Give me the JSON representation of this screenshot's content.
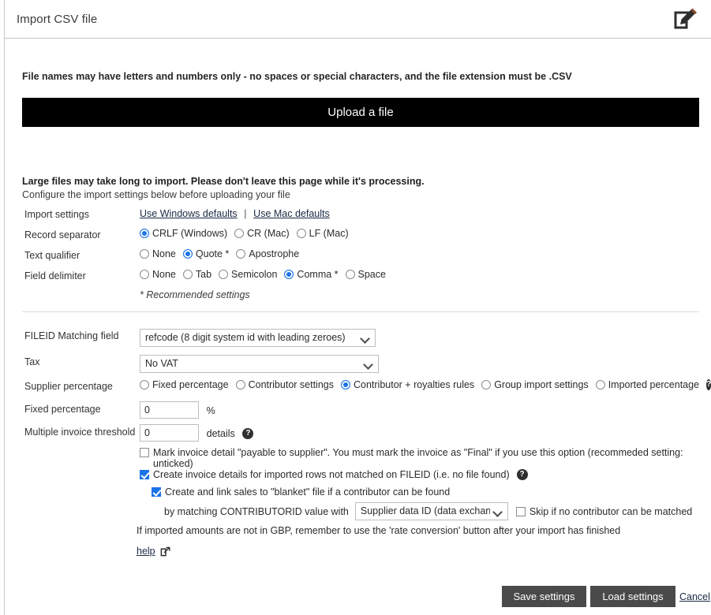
{
  "window": {
    "title": "Import CSV file",
    "edit_icon": "edit-pencil-square-icon"
  },
  "notice": "File names may have letters and numbers only - no spaces or special characters, and the file extension must be .CSV",
  "upload": {
    "label": "Upload a file"
  },
  "warning": {
    "bold": "Large files may take long to import. Please don't leave this page while it's processing.",
    "sub": "Configure the import settings below before uploading your file"
  },
  "import_settings": {
    "label": "Import settings",
    "windows_defaults": "Use Windows defaults",
    "separator": "|",
    "mac_defaults": "Use Mac defaults"
  },
  "record_separator": {
    "label": "Record separator",
    "options": [
      {
        "label": "CRLF (Windows)",
        "checked": true
      },
      {
        "label": "CR (Mac)",
        "checked": false
      },
      {
        "label": "LF (Mac)",
        "checked": false
      }
    ]
  },
  "text_qualifier": {
    "label": "Text qualifier",
    "options": [
      {
        "label": "None",
        "checked": false
      },
      {
        "label": "Quote *",
        "checked": true
      },
      {
        "label": "Apostrophe",
        "checked": false
      }
    ]
  },
  "field_delimiter": {
    "label": "Field delimiter",
    "options": [
      {
        "label": "None",
        "checked": false
      },
      {
        "label": "Tab",
        "checked": false
      },
      {
        "label": "Semicolon",
        "checked": false
      },
      {
        "label": "Comma *",
        "checked": true
      },
      {
        "label": "Space",
        "checked": false
      }
    ]
  },
  "recommended_note": "* Recommended settings",
  "fileid_matching": {
    "label": "FILEID Matching field",
    "value": "refcode (8 digit system id with leading zeroes)",
    "options": [
      "refcode (8 digit system id with leading zeroes)"
    ]
  },
  "tax": {
    "label": "Tax",
    "value": "No VAT",
    "options": [
      "No VAT"
    ]
  },
  "supplier_percentage": {
    "label": "Supplier percentage",
    "options": [
      {
        "label": "Fixed percentage",
        "checked": false
      },
      {
        "label": "Contributor settings",
        "checked": false
      },
      {
        "label": "Contributor + royalties rules",
        "checked": true
      },
      {
        "label": "Group import settings",
        "checked": false
      },
      {
        "label": "Imported percentage",
        "checked": false
      }
    ],
    "help_icon": "help-circle-icon"
  },
  "fixed_percentage": {
    "label": "Fixed percentage",
    "value": "0",
    "suffix": "%"
  },
  "multiple_invoice_threshold": {
    "label": "Multiple invoice threshold",
    "value": "0",
    "suffix": "details",
    "help_icon": "help-circle-icon"
  },
  "checkboxes": {
    "payable_to_supplier": {
      "label": "Mark invoice detail \"payable to supplier\". You must mark the invoice as \"Final\" if you use this option (recommeded setting: unticked)",
      "checked": false
    },
    "create_invoice_details": {
      "label": "Create invoice details for imported rows not matched on FILEID (i.e. no file found)",
      "checked": true,
      "help_icon": "help-circle-icon"
    },
    "create_link_blanket": {
      "label": "Create and link sales to \"blanket\" file if a contributor can be found",
      "checked": true
    },
    "skip_if_no_contributor": {
      "label": "Skip if no contributor can be matched",
      "checked": false
    }
  },
  "matching_row": {
    "prefix": "by matching CONTRIBUTORID value with",
    "value": "Supplier data ID (data exchange)",
    "options": [
      "Supplier data ID (data exchange)"
    ]
  },
  "gbp_note": "If imported amounts are not in GBP, remember to use the 'rate conversion' button after your import has finished",
  "help_link": {
    "label": "help",
    "icon": "external-link-icon"
  },
  "footer": {
    "save_label": "Save settings",
    "load_label": "Load settings",
    "cancel_label": "Cancel"
  },
  "colors": {
    "accent": "#1a73e8",
    "upload_bar": "#000000",
    "button": "#4a4a4a",
    "link": "#1a2a44"
  }
}
